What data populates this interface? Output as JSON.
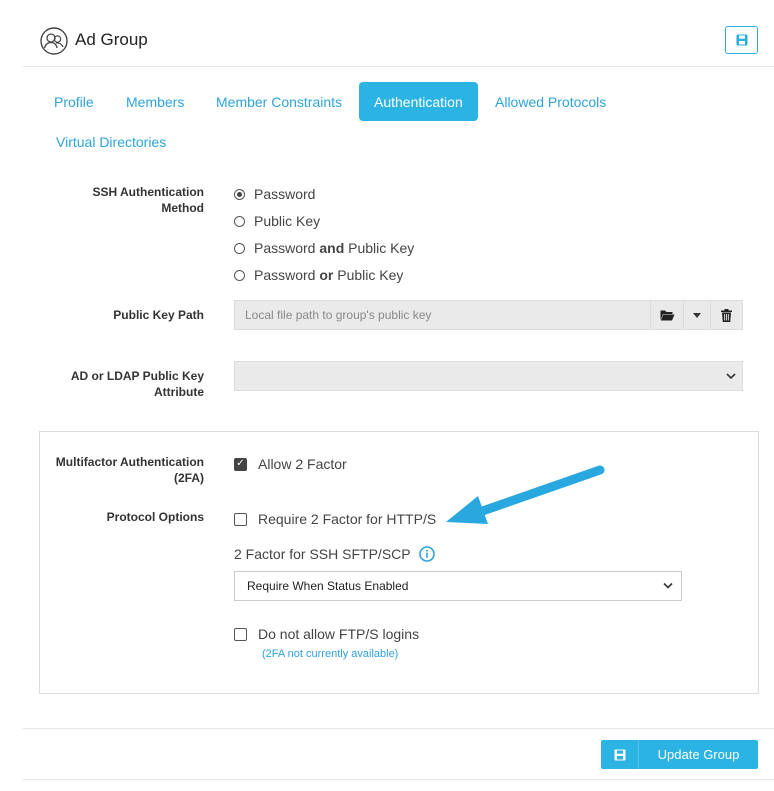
{
  "header": {
    "title": "Ad Group",
    "icon": "user-group-icon",
    "save_icon": "save-icon"
  },
  "tabs": [
    {
      "label": "Profile",
      "active": false
    },
    {
      "label": "Members",
      "active": false
    },
    {
      "label": "Member Constraints",
      "active": false
    },
    {
      "label": "Authentication",
      "active": true
    },
    {
      "label": "Allowed Protocols",
      "active": false
    },
    {
      "label": "Virtual Directories",
      "active": false
    }
  ],
  "ssh_auth": {
    "label_line1": "SSH Authentication",
    "label_line2": "Method",
    "options": [
      {
        "pre": "Password",
        "bold": "",
        "post": "",
        "checked": true
      },
      {
        "pre": "Public Key",
        "bold": "",
        "post": "",
        "checked": false
      },
      {
        "pre": "Password ",
        "bold": "and",
        "post": " Public Key",
        "checked": false
      },
      {
        "pre": "Password ",
        "bold": "or",
        "post": " Public Key",
        "checked": false
      }
    ]
  },
  "public_key_path": {
    "label": "Public Key Path",
    "placeholder": "Local file path to group's public key",
    "folder_icon": "folder-open-icon",
    "caret_icon": "caret-down-icon",
    "trash_icon": "trash-icon"
  },
  "ldap_attr": {
    "label_line1": "AD or LDAP Public Key",
    "label_line2": "Attribute",
    "value": ""
  },
  "mfa": {
    "label_line1": "Multifactor Authentication",
    "label_line2": "(2FA)",
    "allow_label": "Allow 2 Factor",
    "allow_checked": true,
    "protocol_label": "Protocol Options",
    "require_http_label": "Require 2 Factor for HTTP/S",
    "require_http_checked": false,
    "ssh_label": "2 Factor for SSH SFTP/SCP",
    "info_icon": "info-icon",
    "ssh_select_value": "Require When Status Enabled",
    "ftp_label": "Do not allow FTP/S logins",
    "ftp_checked": false,
    "ftp_note": "(2FA not currently available)"
  },
  "footer": {
    "update_label": "Update Group"
  },
  "colors": {
    "accent": "#2ab3e3",
    "link": "#2ea3da",
    "arrow": "#29a8e0"
  }
}
